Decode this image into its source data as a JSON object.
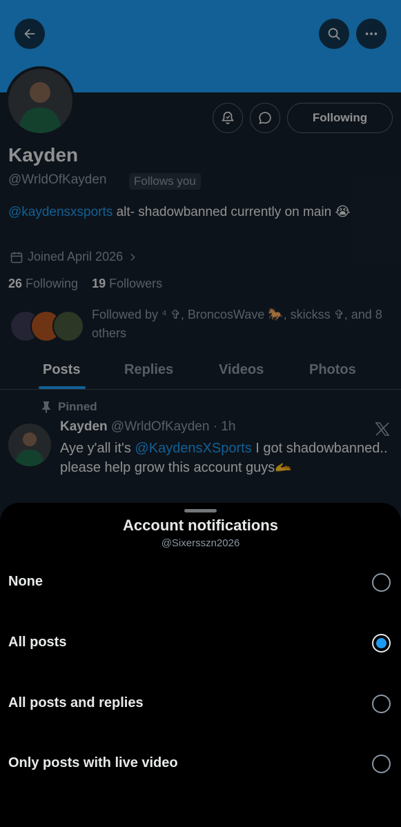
{
  "profile": {
    "name": "Kayden",
    "handle": "@WrldOfKayden",
    "follows_you": "Follows you",
    "bio_mention": "@kaydensxsports",
    "bio_text": " alt- shadowbanned currently on main 😭",
    "joined": "Joined April 2026",
    "following_count": "26",
    "following_label": " Following",
    "followers_count": "19",
    "followers_label": " Followers",
    "followed_by": "Followed by ⁴ ✞, BroncosWave 🐎, skickss ✞, and 8 others",
    "following_button": "Following"
  },
  "tabs": [
    {
      "label": "Posts"
    },
    {
      "label": "Replies"
    },
    {
      "label": "Videos"
    },
    {
      "label": "Photos"
    }
  ],
  "pinned_post": {
    "pinned_label": "Pinned",
    "author": "Kayden",
    "meta": " @WrldOfKayden · 1h",
    "text_start": "Aye y'all it's ",
    "mention": "@KaydensXSports",
    "text_end": "  I got shadowbanned.. please help grow this account guys🫴"
  },
  "sheet": {
    "title": "Account notifications",
    "subtitle": "@Sixersszn2026",
    "options": [
      {
        "label": "None",
        "selected": false
      },
      {
        "label": "All posts",
        "selected": true
      },
      {
        "label": "All posts and replies",
        "selected": false
      },
      {
        "label": "Only posts with live video",
        "selected": false
      }
    ]
  },
  "colors": {
    "accent": "#1d9bf0",
    "background": "#15202b",
    "sheet": "#000000"
  },
  "icons": [
    "back-arrow-icon",
    "search-icon",
    "more-icon",
    "bell-icon",
    "message-icon",
    "calendar-icon",
    "chevron-right-icon",
    "pin-icon",
    "x-logo-icon"
  ]
}
